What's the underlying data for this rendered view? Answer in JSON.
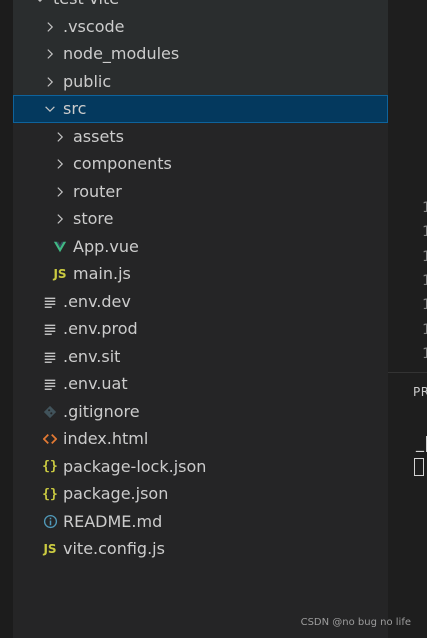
{
  "explorer": {
    "items": [
      {
        "label": "test-vite",
        "type": "folder",
        "expanded": true,
        "depth": 0
      },
      {
        "label": ".vscode",
        "type": "folder",
        "expanded": false,
        "depth": 1
      },
      {
        "label": "node_modules",
        "type": "folder",
        "expanded": false,
        "depth": 1
      },
      {
        "label": "public",
        "type": "folder",
        "expanded": false,
        "depth": 1
      },
      {
        "label": "src",
        "type": "folder",
        "expanded": true,
        "depth": 1,
        "selected": true
      },
      {
        "label": "assets",
        "type": "folder",
        "expanded": false,
        "depth": 2
      },
      {
        "label": "components",
        "type": "folder",
        "expanded": false,
        "depth": 2
      },
      {
        "label": "router",
        "type": "folder",
        "expanded": false,
        "depth": 2
      },
      {
        "label": "store",
        "type": "folder",
        "expanded": false,
        "depth": 2
      },
      {
        "label": "App.vue",
        "type": "vue",
        "depth": 2
      },
      {
        "label": "main.js",
        "type": "js",
        "depth": 2
      },
      {
        "label": ".env.dev",
        "type": "env",
        "depth": 1
      },
      {
        "label": ".env.prod",
        "type": "env",
        "depth": 1
      },
      {
        "label": ".env.sit",
        "type": "env",
        "depth": 1
      },
      {
        "label": ".env.uat",
        "type": "env",
        "depth": 1
      },
      {
        "label": ".gitignore",
        "type": "git",
        "depth": 1
      },
      {
        "label": "index.html",
        "type": "html",
        "depth": 1
      },
      {
        "label": "package-lock.json",
        "type": "json",
        "depth": 1
      },
      {
        "label": "package.json",
        "type": "json",
        "depth": 1
      },
      {
        "label": "README.md",
        "type": "info",
        "depth": 1
      },
      {
        "label": "vite.config.js",
        "type": "js",
        "depth": 1
      }
    ]
  },
  "editor": {
    "line_numbers": [
      "1",
      "1",
      "1",
      "1",
      "1",
      "1",
      "1"
    ]
  },
  "panel": {
    "tab_label": "PR",
    "cursor_glyph": "_|"
  },
  "watermark": "CSDN @no bug no life",
  "colors": {
    "explorer_bg": "#252526",
    "selected_bg": "#04395e",
    "selected_border": "#0e639c",
    "vue": "#41b883",
    "js": "#cbcb41",
    "html": "#e37933",
    "git": "#41535b",
    "info": "#519aba"
  }
}
